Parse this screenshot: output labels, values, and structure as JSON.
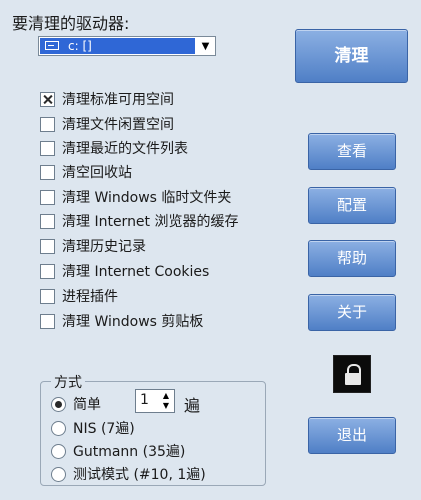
{
  "drive": {
    "label": "要清理的驱动器:",
    "selected": "c: []"
  },
  "actions": {
    "clean": "清理",
    "view": "查看",
    "config": "配置",
    "help": "帮助",
    "about": "关于",
    "exit": "退出"
  },
  "options": [
    {
      "label": "清理标准可用空间",
      "checked": true
    },
    {
      "label": "清理文件闲置空间",
      "checked": false
    },
    {
      "label": "清理最近的文件列表",
      "checked": false
    },
    {
      "label": "清空回收站",
      "checked": false
    },
    {
      "label": "清理 Windows 临时文件夹",
      "checked": false
    },
    {
      "label": "清理 Internet 浏览器的缓存",
      "checked": false
    },
    {
      "label": "清理历史记录",
      "checked": false
    },
    {
      "label": "清理 Internet Cookies",
      "checked": false
    },
    {
      "label": "进程插件",
      "checked": false
    },
    {
      "label": "清理 Windows 剪贴板",
      "checked": false
    }
  ],
  "mode": {
    "legend": "方式",
    "simple_label": "简单",
    "passes_value": "1",
    "passes_unit": "遍",
    "options": [
      {
        "label": "NIS (7遍)"
      },
      {
        "label": "Gutmann (35遍)"
      },
      {
        "label": "测试模式 (#10, 1遍)"
      }
    ]
  },
  "icons": {
    "lock": "lock-icon",
    "drive": "drive-icon"
  },
  "colors": {
    "background": "#dde6ef",
    "button_top": "#8cb0e3",
    "button_bottom": "#4f7fc6",
    "selection": "#2f67d6"
  }
}
